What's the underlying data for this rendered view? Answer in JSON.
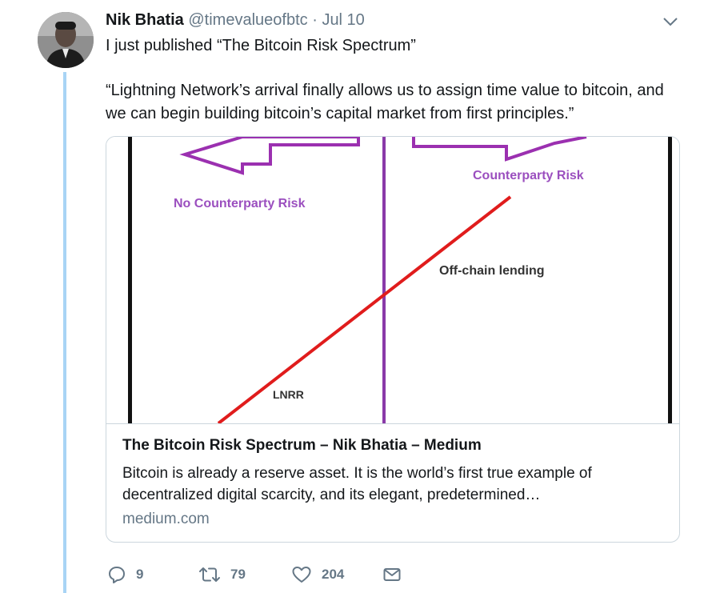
{
  "tweet": {
    "author_name": "Nik Bhatia",
    "author_handle": "@timevalueofbtc",
    "separator": "·",
    "date": "Jul 10",
    "text": "I just published “The Bitcoin Risk Spectrum”",
    "quote_lines": [
      "“Lightning Network’s arrival finally allows us to assign time value to bitcoin, and",
      "we can begin building bitcoin’s capital market from first principles.”"
    ]
  },
  "card": {
    "image_labels": {
      "left": "No Counterparty Risk",
      "right": "Counterparty Risk",
      "upper": "Off-chain lending",
      "lower": "LNRR"
    },
    "image_colors": {
      "arrows": "#9b30b0",
      "label_purple": "#9b4fbf",
      "line": "#e01c1c",
      "divider": "#8a3aa8",
      "borders": "#111111",
      "label_dark": "#333333"
    },
    "title": "The Bitcoin Risk Spectrum – Nik Bhatia – Medium",
    "description_lines": [
      "Bitcoin is already a reserve asset. It is the world’s first true example of",
      "decentralized digital scarcity, and its elegant, predetermined…"
    ],
    "domain": "medium.com"
  },
  "actions": {
    "reply": {
      "icon": "reply-icon",
      "count": "9"
    },
    "retweet": {
      "icon": "retweet-icon",
      "count": "79"
    },
    "like": {
      "icon": "heart-icon",
      "count": "204"
    },
    "dm": {
      "icon": "envelope-icon"
    }
  },
  "colors": {
    "thread_line": "#a8d4f5",
    "secondary_text": "#657786",
    "card_border": "#ccd6dd"
  }
}
